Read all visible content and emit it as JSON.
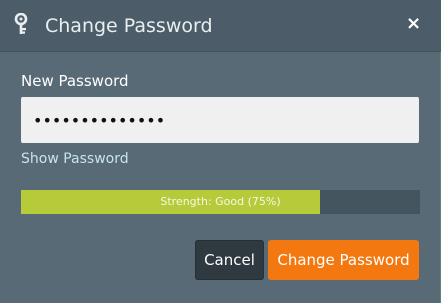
{
  "dialog": {
    "title": "Change Password",
    "title_icon": "key-icon",
    "close_label": "×"
  },
  "form": {
    "new_password_label": "New Password",
    "password_value": "••••••••••••••",
    "show_password_label": "Show Password"
  },
  "strength": {
    "text": "Strength: Good (75%)",
    "percent": 75,
    "fill_color": "#b7cb3a",
    "track_color": "#45555f"
  },
  "buttons": {
    "cancel_label": "Cancel",
    "change_label": "Change Password",
    "primary_color": "#f47810"
  }
}
